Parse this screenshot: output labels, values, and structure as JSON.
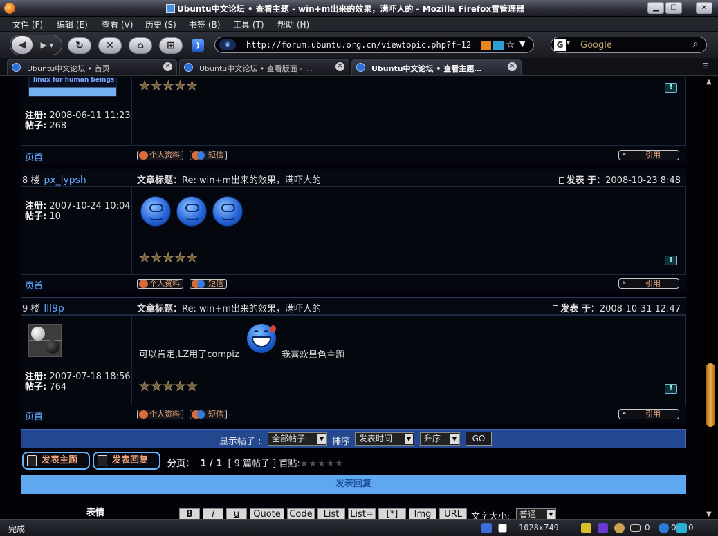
{
  "window": {
    "title": "Ubuntu中文论坛 • 查看主题 - win+m出来的效果，满吓人的 - Mozilla Firefox",
    "overlay": "置管理器"
  },
  "menu": [
    "文件 (F)",
    "编辑 (E)",
    "查看 (V)",
    "历史 (S)",
    "书签 (B)",
    "工具 (T)",
    "帮助 (H)"
  ],
  "nav": {
    "url": "http://forum.ubuntu.org.cn/viewtopic.php?f=12",
    "search_placeholder": "Google"
  },
  "tabs": [
    {
      "label": "Ubuntu中文论坛 • 首页"
    },
    {
      "label": "Ubuntu中文论坛 • 查看版面 - …"
    },
    {
      "label": "Ubuntu中文论坛 • 查看主题…"
    }
  ],
  "labels": {
    "register": "注册:",
    "posts": "帖子:",
    "subject": "文章标题：",
    "posted": "发表 于：",
    "top": "页首",
    "profile": "个人资料",
    "pm": "短信",
    "quote": "引用"
  },
  "logo_text": "linux for human beings",
  "posts": [
    {
      "floor": "",
      "author": "",
      "register": "2008-06-11 11:23",
      "count": "268"
    },
    {
      "floor": "8 楼",
      "author": "px_lypsh",
      "subject": "Re: win+m出来的效果，满吓人的",
      "posted": "2008-10-23 8:48",
      "register": "2007-10-24 10:04",
      "count": "10"
    },
    {
      "floor": "9 楼",
      "author": "lll9p",
      "subject": "Re: win+m出来的效果，满吓人的",
      "posted": "2008-10-31 12:47",
      "register": "2007-07-18 18:56",
      "count": "764",
      "text1": "可以肯定,LZ用了compiz",
      "text2": "我喜欢黑色主题"
    }
  ],
  "options": {
    "show_label": "显示帖子 :",
    "show_value": "全部帖子",
    "sort_label": "排序",
    "sort_value": "发表时间",
    "order_value": "升序",
    "go": "GO"
  },
  "actions": {
    "new_topic": "发表主题",
    "reply": "发表回复",
    "pages_label": "分页：",
    "pages_value": "1 / 1",
    "post_count": "[ 9 篇帖子 ]",
    "home": "首贴:",
    "stars": "★★★★★"
  },
  "reply_form": {
    "header": "发表回复",
    "emoticons": "表情",
    "buttons": [
      "B",
      "i",
      "u",
      "Quote",
      "Code",
      "List",
      "List=",
      "[*]",
      "Img",
      "URL"
    ],
    "font_size_label": "文字大小:",
    "font_size_value": "普通"
  },
  "status": {
    "text": "完成",
    "resolution": "1028x749",
    "count1": "0",
    "count2": "0",
    "count3": "0"
  },
  "colors": {
    "accent": "#5fa8ff",
    "option_bar": "#23488f",
    "reply_header": "#5fa8f0",
    "scroll_thumb": "#f0b14e"
  }
}
